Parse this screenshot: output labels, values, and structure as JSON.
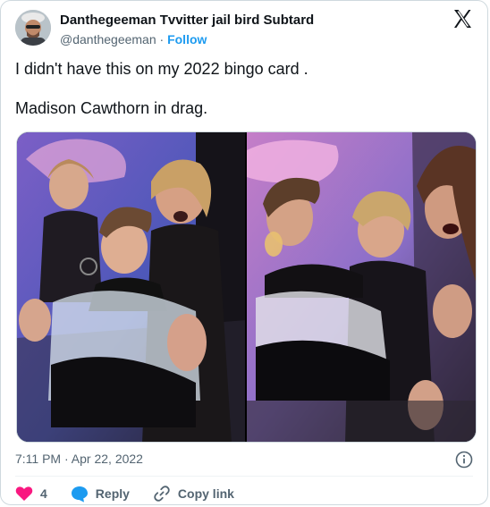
{
  "tweet": {
    "author": {
      "display_name": "Danthegeeman Tvvitter jail bird Subtard",
      "handle": "@danthegeeman",
      "separator": "·",
      "follow_label": "Follow"
    },
    "text": {
      "line1": "I didn't have this on my 2022 bingo card .",
      "line2": "Madison Cawthorn in drag."
    },
    "timestamp": {
      "time": "7:11 PM",
      "separator": "·",
      "date": "Apr 22, 2022"
    },
    "actions": {
      "like_count": "4",
      "reply_label": "Reply",
      "copy_link_label": "Copy link"
    },
    "icons": {
      "platform": "x-logo-icon",
      "info": "info-icon",
      "like": "heart-icon",
      "reply": "speech-bubble-icon",
      "copy_link": "link-icon"
    },
    "colors": {
      "like": "#f91880",
      "reply": "#1d9bf0",
      "follow": "#1d9bf0",
      "secondary_text": "#536471"
    }
  }
}
